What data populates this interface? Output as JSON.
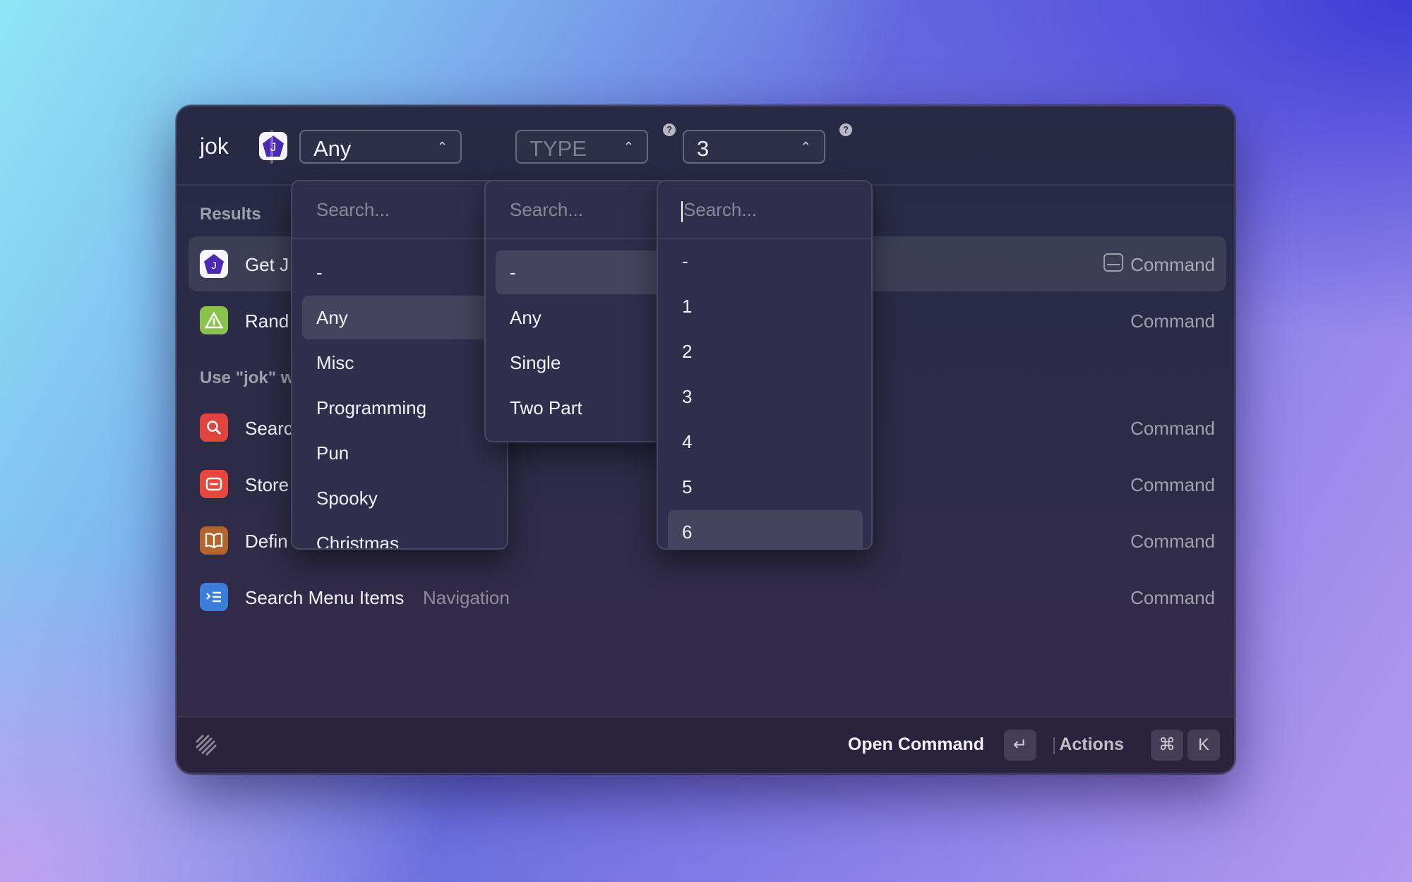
{
  "query": "jok",
  "filters": {
    "category": {
      "value": "Any"
    },
    "type": {
      "value": "",
      "placeholder": "TYPE"
    },
    "amount": {
      "value": "3"
    }
  },
  "sections": {
    "results": "Results",
    "use_with": "Use \"jok\" w"
  },
  "rows": [
    {
      "title": "Get J",
      "subtitle": "",
      "kind": "Command"
    },
    {
      "title": "Rand",
      "subtitle": "",
      "kind": "Command"
    },
    {
      "title": "Searc",
      "subtitle": "",
      "kind": "Command"
    },
    {
      "title": "Store",
      "subtitle": "",
      "kind": "Command"
    },
    {
      "title": "Defin",
      "subtitle": "",
      "kind": "Command"
    },
    {
      "title": "Search Menu Items",
      "subtitle": "Navigation",
      "kind": "Command"
    }
  ],
  "menus": {
    "category": {
      "placeholder": "Search...",
      "options": [
        "-",
        "Any",
        "Misc",
        "Programming",
        "Pun",
        "Spooky",
        "Christmas"
      ],
      "highlighted": "Any"
    },
    "type": {
      "placeholder": "Search...",
      "options": [
        "-",
        "Any",
        "Single",
        "Two Part"
      ],
      "highlighted": "-"
    },
    "amount": {
      "placeholder": "Search...",
      "options": [
        "-",
        "1",
        "2",
        "3",
        "4",
        "5",
        "6"
      ],
      "highlighted": "6"
    }
  },
  "footer": {
    "primary_action": "Open Command",
    "enter_key": "↵",
    "actions_label": "Actions",
    "cmd_key": "⌘",
    "k_key": "K"
  },
  "icons": {
    "extension": "joke-pentagon-icon",
    "random": "warning-triangle-icon",
    "search": "magnifier-icon",
    "store": "store-icon",
    "define": "book-icon",
    "menu_items": "list-icon",
    "disk": "disk-icon",
    "logo": "raycast-logo-icon"
  },
  "colors": {
    "random_icon": "#8bc34a",
    "search_icon": "#e0453c",
    "store_icon": "#e8473e",
    "define_icon": "#b5642c",
    "menu_items_icon": "#3b7ddb",
    "extension_icon": "#4b2ab0"
  }
}
